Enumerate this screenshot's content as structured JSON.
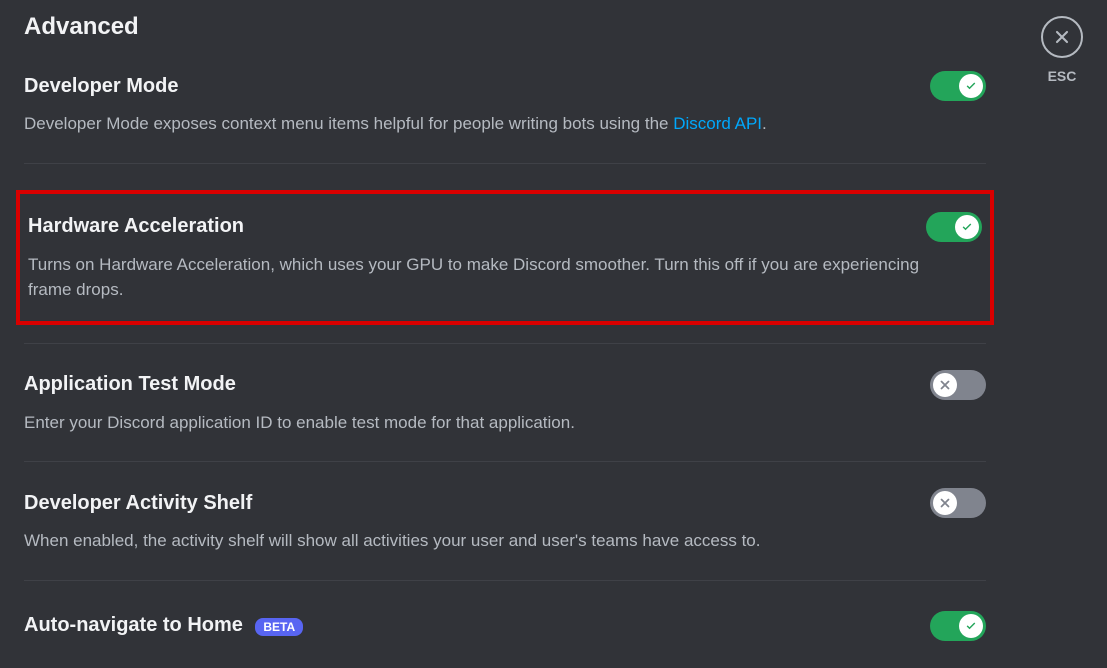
{
  "page": {
    "title": "Advanced"
  },
  "close": {
    "label": "ESC"
  },
  "settings": {
    "developer_mode": {
      "title": "Developer Mode",
      "description_prefix": "Developer Mode exposes context menu items helpful for people writing bots using the ",
      "link_text": "Discord API",
      "description_suffix": ".",
      "enabled": true
    },
    "hardware_acceleration": {
      "title": "Hardware Acceleration",
      "description": "Turns on Hardware Acceleration, which uses your GPU to make Discord smoother. Turn this off if you are experiencing frame drops.",
      "enabled": true
    },
    "application_test_mode": {
      "title": "Application Test Mode",
      "description": "Enter your Discord application ID to enable test mode for that application.",
      "enabled": false
    },
    "developer_activity_shelf": {
      "title": "Developer Activity Shelf",
      "description": "When enabled, the activity shelf will show all activities your user and user's teams have access to.",
      "enabled": false
    },
    "auto_navigate_home": {
      "title": "Auto-navigate to Home",
      "badge": "BETA",
      "enabled": true
    }
  }
}
